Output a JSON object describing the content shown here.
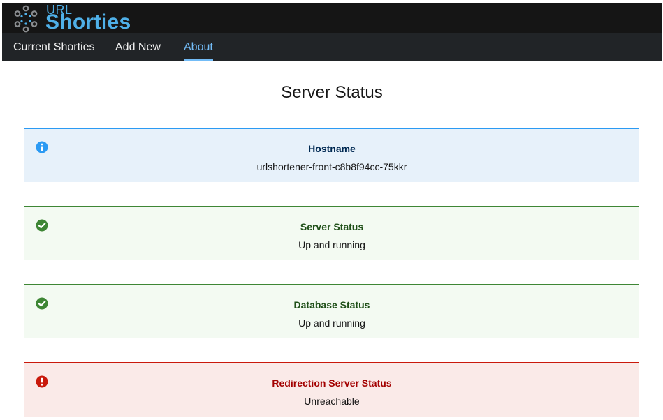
{
  "brand": {
    "top": "URL",
    "main": "Shorties",
    "logo_icon": "dots-circle-logo-icon",
    "color": "#4fb0e8"
  },
  "nav": {
    "items": [
      {
        "label": "Current Shorties",
        "active": false
      },
      {
        "label": "Add New",
        "active": false
      },
      {
        "label": "About",
        "active": true
      }
    ],
    "active_color": "#73bcf7"
  },
  "page": {
    "title": "Server Status"
  },
  "alerts": [
    {
      "variant": "info",
      "icon": "info-circle-icon",
      "title": "Hostname",
      "body": "urlshortener-front-c8b8f94cc-75kkr",
      "color": "#2b9af3"
    },
    {
      "variant": "success",
      "icon": "check-circle-icon",
      "title": "Server Status",
      "body": "Up and running",
      "color": "#3e8635"
    },
    {
      "variant": "success",
      "icon": "check-circle-icon",
      "title": "Database Status",
      "body": "Up and running",
      "color": "#3e8635"
    },
    {
      "variant": "danger",
      "icon": "exclamation-circle-icon",
      "title": "Redirection Server Status",
      "body": "Unreachable",
      "color": "#c9190b"
    }
  ]
}
